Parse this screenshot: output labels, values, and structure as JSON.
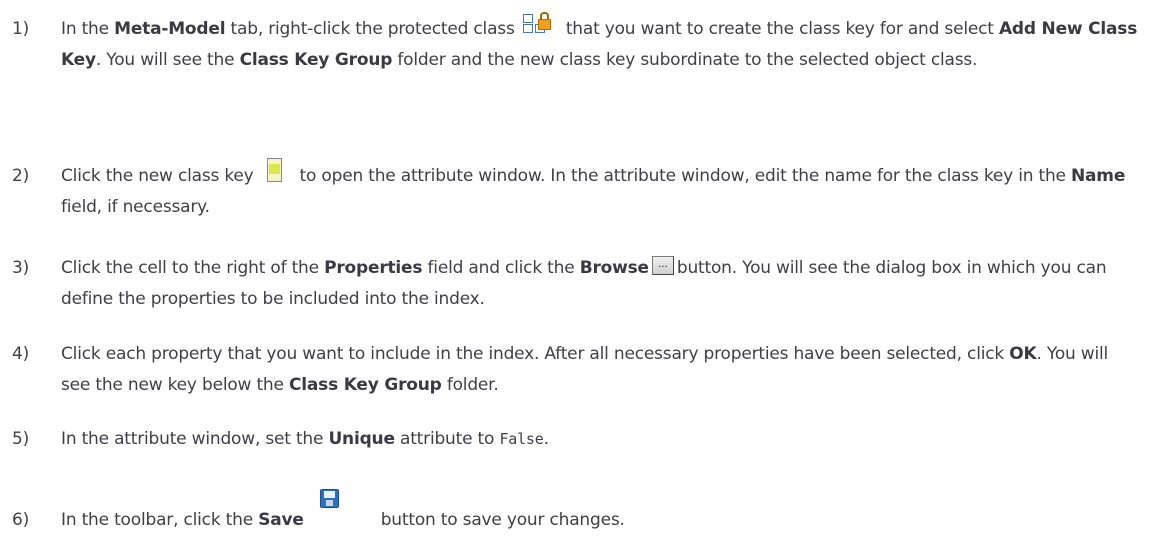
{
  "steps": [
    {
      "num": "1)",
      "parts": {
        "a": "In the ",
        "b": "Meta-Model",
        "c": " tab, right-click the protected class",
        "d": " that you want to create the class key for and select ",
        "e": "Add New Class Key",
        "f": ". You will see the ",
        "g": "Class Key Group",
        "h": " folder and the new class key subordinate to the selected object class."
      },
      "icon": "protected-class-icon"
    },
    {
      "num": "2)",
      "parts": {
        "a": "Click the new class key",
        "b": "to open the attribute window. In the attribute window, edit the name for the class key in the ",
        "c": "Name",
        "d": " field, if necessary."
      },
      "icon": "class-key-icon"
    },
    {
      "num": "3)",
      "parts": {
        "a": "Click the cell to the right of the ",
        "b": "Properties",
        "c": " field and click the ",
        "d": "Browse",
        "e": "button. You will see the dialog box in which you can define the properties to be included into the index."
      },
      "icon": "browse-button-icon",
      "browse_glyph": "..."
    },
    {
      "num": "4)",
      "parts": {
        "a": "Click each property that you want to include in the index. After all necessary properties have been selected, click ",
        "b": "OK",
        "c": ". You will see the new key below the ",
        "d": "Class Key Group",
        "e": " folder."
      }
    },
    {
      "num": "5)",
      "parts": {
        "a": "In the attribute window, set the ",
        "b": "Unique",
        "c": " attribute to ",
        "d": "False",
        "e": "."
      }
    },
    {
      "num": "6)",
      "parts": {
        "a": "In the toolbar, click the ",
        "b": "Save",
        "c": "button to save your changes."
      },
      "icon": "save-icon"
    }
  ]
}
